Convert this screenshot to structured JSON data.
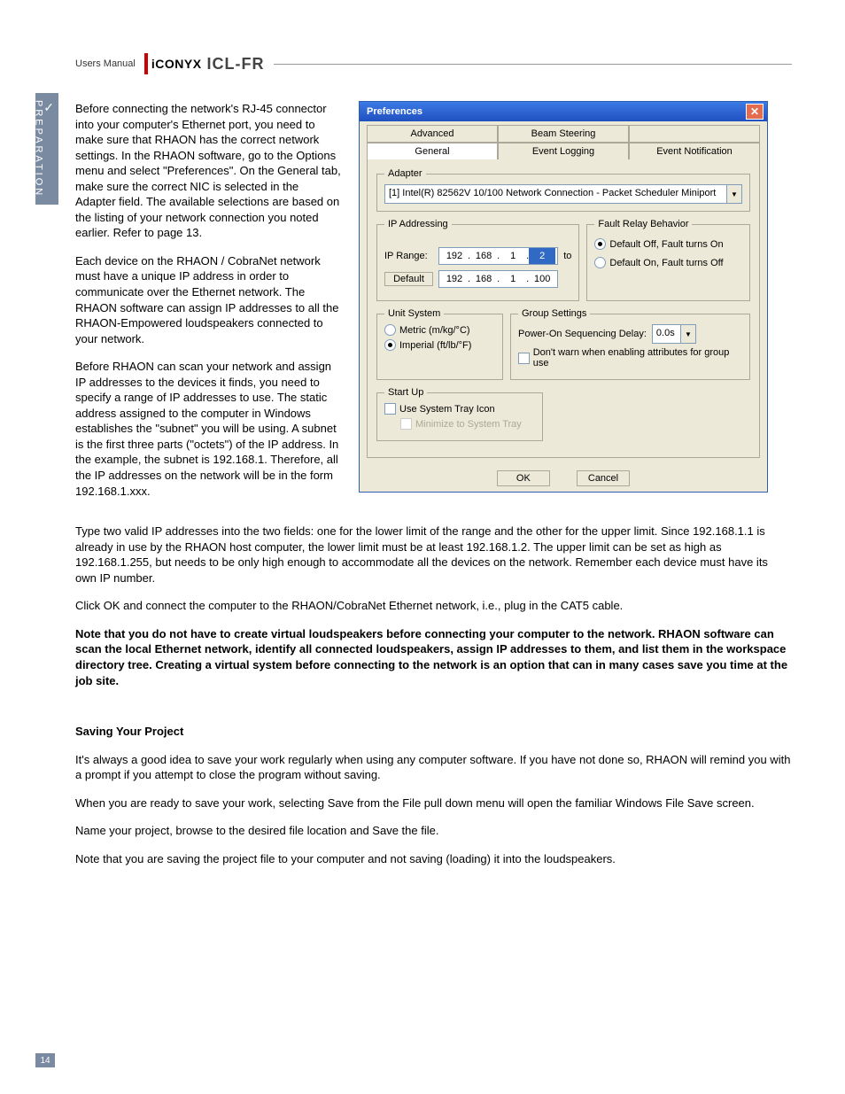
{
  "header": {
    "label": "Users Manual",
    "brand": "iCONYX",
    "model": "ICL-FR"
  },
  "sidebar": {
    "label": "PREPARATION"
  },
  "body": {
    "p1": "Before connecting the network's  RJ-45 connector into your computer's Ethernet port, you need to make sure that RHAON has the correct network settings.  In the RHAON software, go to the Options menu and select \"Preferences\".  On the General tab, make sure the correct NIC is selected in the Adapter field.  The available selections are based on the listing of your network connection you noted earlier. Refer to page 13.",
    "p2": "Each device on the RHAON / CobraNet network must have a unique IP address in order to communicate over the Ethernet network.  The RHAON software can assign IP addresses to all the RHAON-Empowered loudspeakers connected to your network.",
    "p3": "Before RHAON can scan your network and assign IP addresses to the devices it finds, you need to specify a range of IP addresses to use.  The static address assigned to the computer in Windows establishes the \"subnet\" you will be using.  A subnet is the first three parts (\"octets\") of the IP address.  In the example, the subnet is 192.168.1.  Therefore, all the IP addresses on the network will be in the form 192.168.1.xxx.",
    "p4": "Type two valid IP addresses into the two fields: one for the lower limit of the range and the other for the upper limit.  Since 192.168.1.1 is already in use by the RHAON host computer, the lower limit must be at least 192.168.1.2.  The upper limit can be set as high as 192.168.1.255, but needs to be only high enough to accommodate all the devices on the network. Remember each device must have its own IP number.",
    "p5": "Click OK and connect the computer to the RHAON/CobraNet Ethernet network, i.e., plug in the CAT5 cable.",
    "p6_bold": "Note that  you do not have to create virtual loudspeakers before connecting your computer to the network. RHAON software can scan the local Ethernet network, identify all connected loudspeakers, assign IP addresses to them, and list them in the workspace directory tree. Creating a virtual system before connecting to the network is an option that can in many cases save you time at the job site.",
    "h_saving": "Saving Your Project",
    "p7": "It's always a good idea to save your work regularly when using any computer software. If you have not done so, RHAON will remind you with a prompt if you attempt to close the program without saving.",
    "p8": "When you are ready to save your work, selecting Save from the File pull down menu will open the familiar Windows File Save screen.",
    "p9": "Name your project, browse to the desired file location and Save the file.",
    "p10": "Note that you are saving the project file to your computer and not saving (loading) it into the loudspeakers."
  },
  "dialog": {
    "title": "Preferences",
    "tabs_back": [
      "Advanced",
      "Beam Steering",
      ""
    ],
    "tabs_front": [
      "General",
      "Event Logging",
      "Event Notification"
    ],
    "adapter": {
      "legend": "Adapter",
      "value": "[1] Intel(R) 82562V 10/100 Network Connection - Packet Scheduler Miniport"
    },
    "ip": {
      "legend": "IP Addressing",
      "range_label": "IP Range:",
      "to_label": "to",
      "default_btn": "Default",
      "lo": [
        "192",
        "168",
        "1",
        "2"
      ],
      "hi": [
        "192",
        "168",
        "1",
        "100"
      ]
    },
    "fault": {
      "legend": "Fault Relay Behavior",
      "opt1": "Default Off, Fault turns On",
      "opt2": "Default On, Fault turns Off"
    },
    "unit": {
      "legend": "Unit System",
      "metric": "Metric (m/kg/°C)",
      "imperial": "Imperial (ft/lb/°F)"
    },
    "group": {
      "legend": "Group Settings",
      "delay_label": "Power-On Sequencing Delay:",
      "delay_value": "0.0s",
      "warn_label": "Don't warn when enabling attributes for group use"
    },
    "startup": {
      "legend": "Start Up",
      "tray": "Use System Tray Icon",
      "minimize": "Minimize to System Tray"
    },
    "ok": "OK",
    "cancel": "Cancel"
  },
  "page_number": "14"
}
